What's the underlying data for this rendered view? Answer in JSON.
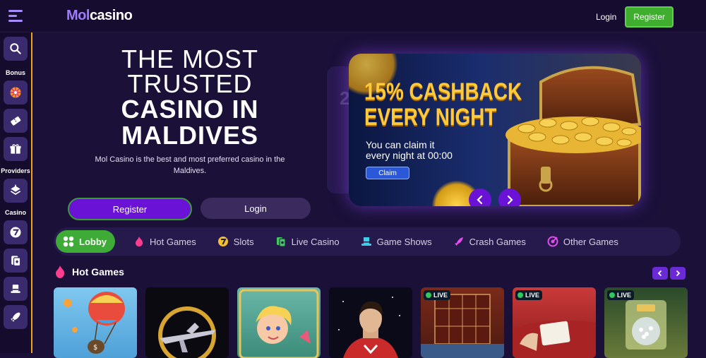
{
  "header": {
    "logo_mol": "Mol",
    "logo_casino": "casino",
    "login_label": "Login",
    "register_label": "Register"
  },
  "sidebar": {
    "sections": [
      {
        "label": "Bonus",
        "items": [
          "wheel-icon",
          "ticket-icon",
          "gift-icon"
        ]
      },
      {
        "label": "Providers",
        "items": [
          "stack-icon"
        ]
      },
      {
        "label": "Casino",
        "items": [
          "seven-icon",
          "cards-icon",
          "hat-icon",
          "rocket-icon"
        ]
      }
    ]
  },
  "hero": {
    "line1": "THE MOST",
    "line2": "TRUSTED",
    "line3": "CASINO IN",
    "line4": "MALDIVES",
    "description": "Mol Casino is the best and most preferred casino in the Maldives.",
    "register_label": "Register",
    "login_label": "Login"
  },
  "banner": {
    "headline_1": "15% CASHBACK",
    "headline_2": "EVERY NIGHT",
    "sub_1": "You can claim it",
    "sub_2": "every night at 00:00",
    "claim_label": "Claim",
    "behind_slide_char": "2",
    "colors": {
      "gold": "#ffc93c",
      "claim_blue": "#2a58d8"
    }
  },
  "categories": [
    {
      "label": "Lobby",
      "icon": "grid-icon",
      "active": true
    },
    {
      "label": "Hot Games",
      "icon": "flame-icon",
      "active": false
    },
    {
      "label": "Slots",
      "icon": "slot-seven-icon",
      "active": false
    },
    {
      "label": "Live Casino",
      "icon": "live-cards-icon",
      "active": false
    },
    {
      "label": "Game Shows",
      "icon": "top-hat-icon",
      "active": false
    },
    {
      "label": "Crash Games",
      "icon": "rocket-icon",
      "active": false
    },
    {
      "label": "Other Games",
      "icon": "target-icon",
      "active": false
    }
  ],
  "hot_games": {
    "title": "Hot Games",
    "live_label": "LIVE",
    "games": [
      {
        "theme": "balloon",
        "live": false
      },
      {
        "theme": "jet",
        "live": false
      },
      {
        "theme": "cupid",
        "live": false
      },
      {
        "theme": "hero",
        "live": false
      },
      {
        "theme": "live-table",
        "live": true
      },
      {
        "theme": "live-cards",
        "live": true
      },
      {
        "theme": "live-lottery",
        "live": true
      }
    ]
  },
  "colors": {
    "background": "#1a1038",
    "accent_purple": "#6a13d6",
    "accent_green": "#3dab36",
    "sidebar_border": "#f2a024"
  }
}
